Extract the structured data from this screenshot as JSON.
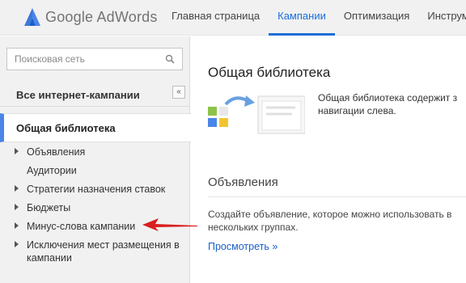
{
  "header": {
    "logo_google": "Google",
    "logo_product": "AdWords",
    "nav": [
      {
        "label": "Главная страница",
        "active": false
      },
      {
        "label": "Кампании",
        "active": true
      },
      {
        "label": "Оптимизация",
        "active": false
      },
      {
        "label": "Инструм",
        "active": false
      }
    ]
  },
  "sidebar": {
    "search_placeholder": "Поисковая сеть",
    "all_campaigns": "Все интернет-кампании",
    "collapse_label": "«",
    "library_label": "Общая библиотека",
    "tree": [
      {
        "label": "Объявления",
        "expandable": true
      },
      {
        "label": "Аудитории",
        "expandable": false
      },
      {
        "label": "Стратегии назначения ставок",
        "expandable": true
      },
      {
        "label": "Бюджеты",
        "expandable": true
      },
      {
        "label": "Минус-слова кампании",
        "expandable": true
      },
      {
        "label": "Исключения мест размещения в",
        "label2": "кампании",
        "expandable": true
      }
    ]
  },
  "main": {
    "title": "Общая библиотека",
    "desc_line1": "Общая библиотека содержит з",
    "desc_line2": "навигации слева.",
    "ads_title": "Объявления",
    "ads_desc_line1": "Создайте объявление, которое можно использовать в",
    "ads_desc_line2": "нескольких группах.",
    "view_link": "Просмотреть »"
  },
  "colors": {
    "accent": "#1a6ed8",
    "sidebar_bg": "#f1f1f1",
    "annotation_arrow": "#d91f1f"
  }
}
